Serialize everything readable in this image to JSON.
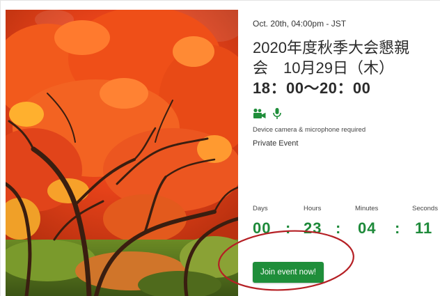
{
  "event": {
    "date_time": "Oct. 20th, 04:00pm - JST",
    "title_line1": "2020年度秋季大会懇親",
    "title_line2": "会　10月29日（木）",
    "title_line3": "18：00～20：00",
    "device_requirement": "Device camera & microphone required",
    "privacy": "Private Event"
  },
  "countdown": {
    "days_label": "Days",
    "hours_label": "Hours",
    "minutes_label": "Minutes",
    "seconds_label": "Seconds",
    "days": "00",
    "hours": "23",
    "minutes": "04",
    "seconds": "11",
    "separator": ":"
  },
  "join_button": {
    "label": "Join event now!"
  },
  "icons": {
    "camera": "video-camera-icon",
    "microphone": "microphone-icon"
  },
  "colors": {
    "accent_green": "#1f8e3a",
    "countdown_green": "#1e8a3a",
    "annotation_red": "#b51f24"
  }
}
